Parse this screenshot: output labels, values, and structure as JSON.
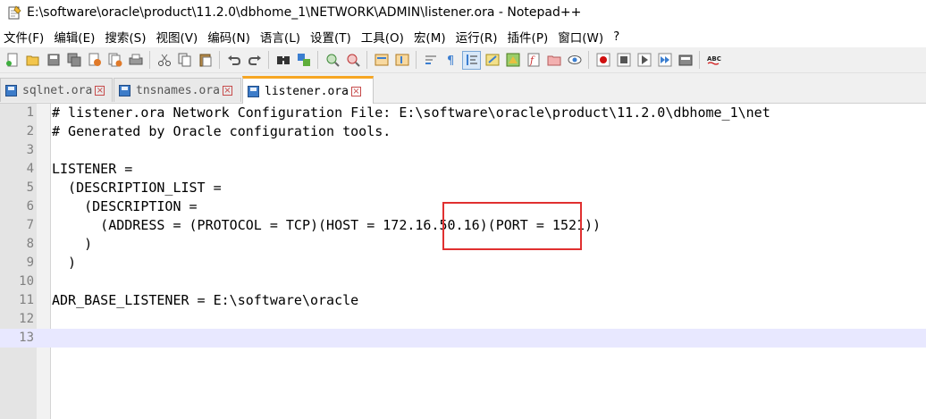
{
  "window": {
    "title": "E:\\software\\oracle\\product\\11.2.0\\dbhome_1\\NETWORK\\ADMIN\\listener.ora - Notepad++",
    "app_icon": "notepad-icon"
  },
  "menu": {
    "items": [
      "文件(F)",
      "编辑(E)",
      "搜索(S)",
      "视图(V)",
      "编码(N)",
      "语言(L)",
      "设置(T)",
      "工具(O)",
      "宏(M)",
      "运行(R)",
      "插件(P)",
      "窗口(W)",
      "?"
    ]
  },
  "toolbar": {
    "buttons": [
      "new-file-icon",
      "open-file-icon",
      "save-icon",
      "save-all-icon",
      "close-icon",
      "close-all-icon",
      "print-icon",
      "cut-icon",
      "copy-icon",
      "paste-icon",
      "undo-icon",
      "redo-icon",
      "find-icon",
      "replace-icon",
      "zoom-in-icon",
      "zoom-out-icon",
      "sync-vertical-icon",
      "sync-horizontal-icon",
      "word-wrap-icon",
      "show-all-chars-icon",
      "indent-guide-icon",
      "user-defined-lang-icon",
      "doc-map-icon",
      "function-list-icon",
      "folder-workspace-icon",
      "monitoring-icon",
      "record-macro-icon",
      "stop-macro-icon",
      "play-macro-icon",
      "run-macro-multiple-icon",
      "save-macro-icon",
      "spell-check-icon"
    ],
    "spell_check_label": "ABC"
  },
  "tabs": [
    {
      "label": "sqlnet.ora",
      "active": false
    },
    {
      "label": "tnsnames.ora",
      "active": false
    },
    {
      "label": "listener.ora",
      "active": true
    }
  ],
  "editor": {
    "current_line": 13,
    "lines": [
      {
        "num": "1",
        "text": "# listener.ora Network Configuration File: E:\\software\\oracle\\product\\11.2.0\\dbhome_1\\net"
      },
      {
        "num": "2",
        "text": "# Generated by Oracle configuration tools."
      },
      {
        "num": "3",
        "text": ""
      },
      {
        "num": "4",
        "text": "LISTENER ="
      },
      {
        "num": "5",
        "text": "  (DESCRIPTION_LIST ="
      },
      {
        "num": "6",
        "text": "    (DESCRIPTION ="
      },
      {
        "num": "7",
        "text": "      (ADDRESS = (PROTOCOL = TCP)(HOST = 172.16.50.16)(PORT = 1521))"
      },
      {
        "num": "8",
        "text": "    )"
      },
      {
        "num": "9",
        "text": "  )"
      },
      {
        "num": "10",
        "text": ""
      },
      {
        "num": "11",
        "text": "ADR_BASE_LISTENER = E:\\software\\oracle"
      },
      {
        "num": "12",
        "text": ""
      },
      {
        "num": "13",
        "text": ""
      }
    ]
  },
  "annotation": {
    "color": "#e03030"
  }
}
